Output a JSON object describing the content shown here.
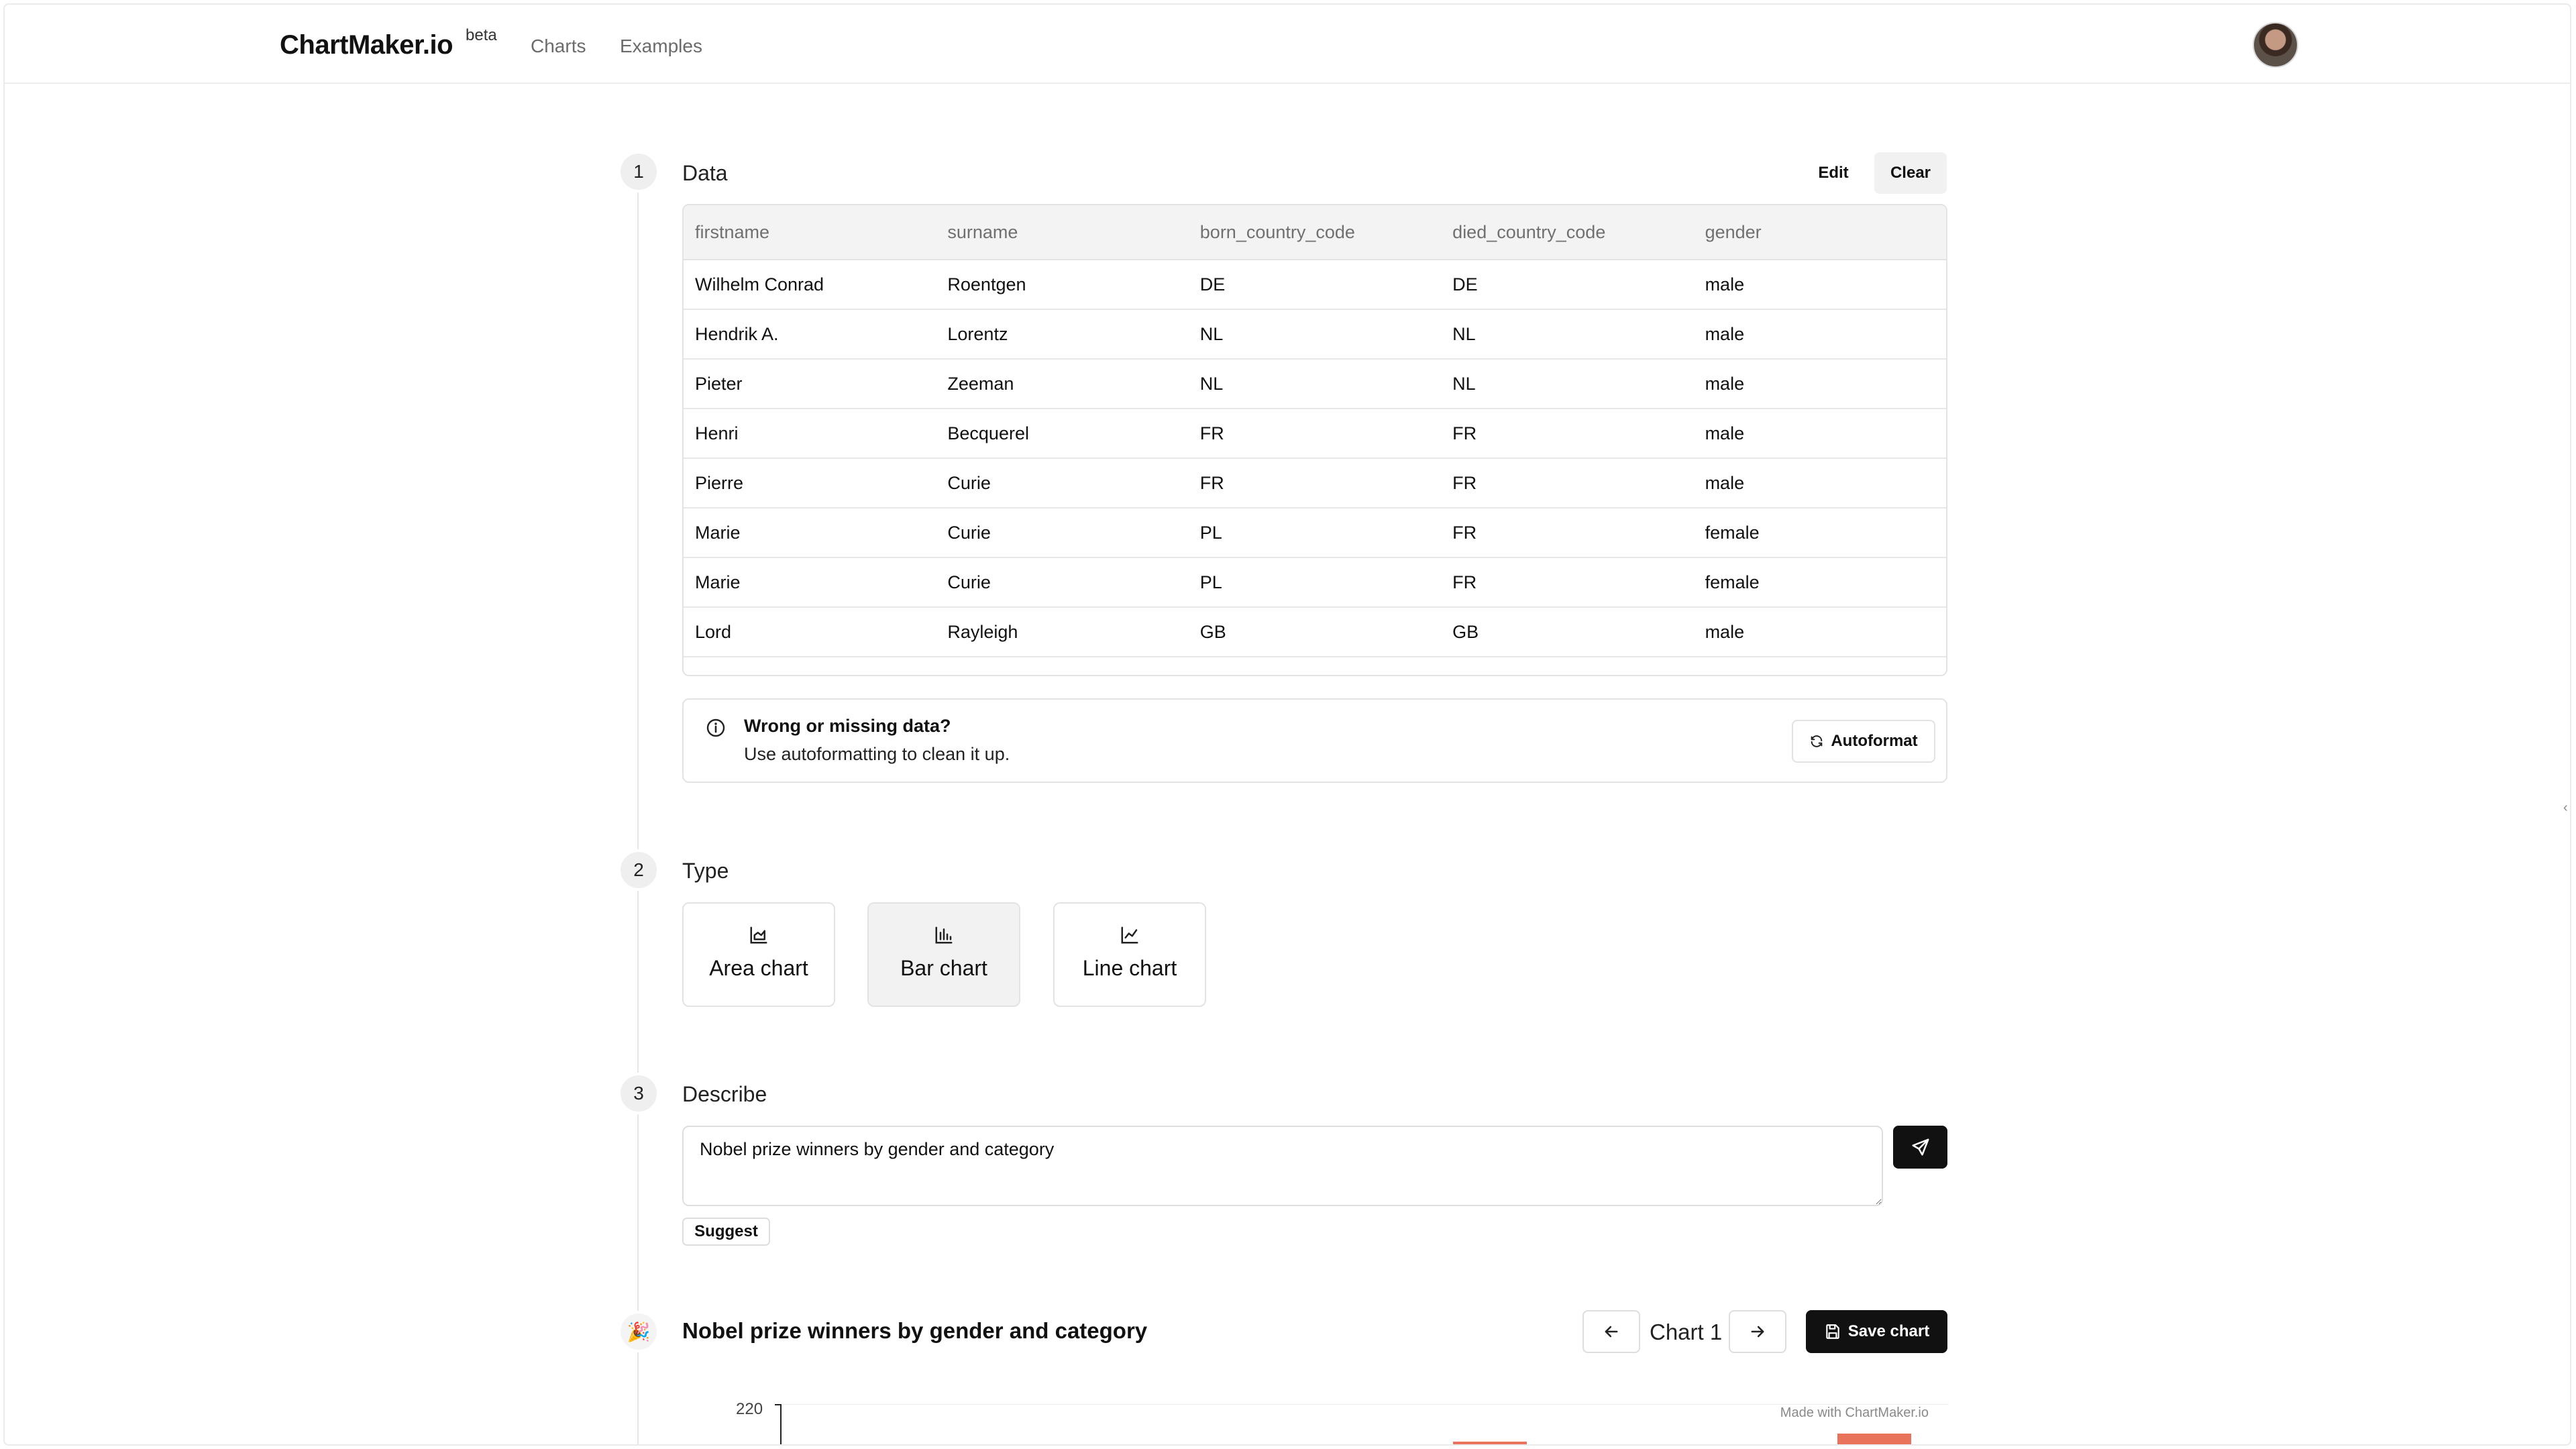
{
  "header": {
    "logo": "ChartMaker.io",
    "badge": "beta",
    "nav": [
      "Charts",
      "Examples"
    ]
  },
  "steps": {
    "data": {
      "number": "1",
      "title": "Data",
      "edit_label": "Edit",
      "clear_label": "Clear"
    },
    "type": {
      "number": "2",
      "title": "Type"
    },
    "describe": {
      "number": "3",
      "title": "Describe"
    }
  },
  "table": {
    "columns": [
      "firstname",
      "surname",
      "born_country_code",
      "died_country_code",
      "gender"
    ],
    "rows": [
      [
        "Wilhelm Conrad",
        "Roentgen",
        "DE",
        "DE",
        "male"
      ],
      [
        "Hendrik A.",
        "Lorentz",
        "NL",
        "NL",
        "male"
      ],
      [
        "Pieter",
        "Zeeman",
        "NL",
        "NL",
        "male"
      ],
      [
        "Henri",
        "Becquerel",
        "FR",
        "FR",
        "male"
      ],
      [
        "Pierre",
        "Curie",
        "FR",
        "FR",
        "male"
      ],
      [
        "Marie",
        "Curie",
        "PL",
        "FR",
        "female"
      ],
      [
        "Marie",
        "Curie",
        "PL",
        "FR",
        "female"
      ],
      [
        "Lord",
        "Rayleigh",
        "GB",
        "GB",
        "male"
      ]
    ]
  },
  "notice": {
    "title": "Wrong or missing data?",
    "body": "Use autoformatting to clean it up.",
    "button": "Autoformat"
  },
  "chart_types": [
    {
      "label": "Area chart",
      "icon": "area-chart-icon",
      "selected": false
    },
    {
      "label": "Bar chart",
      "icon": "bar-chart-icon",
      "selected": true
    },
    {
      "label": "Line chart",
      "icon": "line-chart-icon",
      "selected": false
    }
  ],
  "describe": {
    "value": "Nobel prize winners by gender and category",
    "suggest_label": "Suggest"
  },
  "result": {
    "title": "Nobel prize winners by gender and category",
    "chart_index": "Chart 1",
    "save_label": "Save chart",
    "watermark": "Made with ChartMaker.io",
    "y_tick_top": "220"
  },
  "colors": {
    "accent": "#111111",
    "bar": "#e8735a",
    "selected_card": "#f2f2f2"
  }
}
